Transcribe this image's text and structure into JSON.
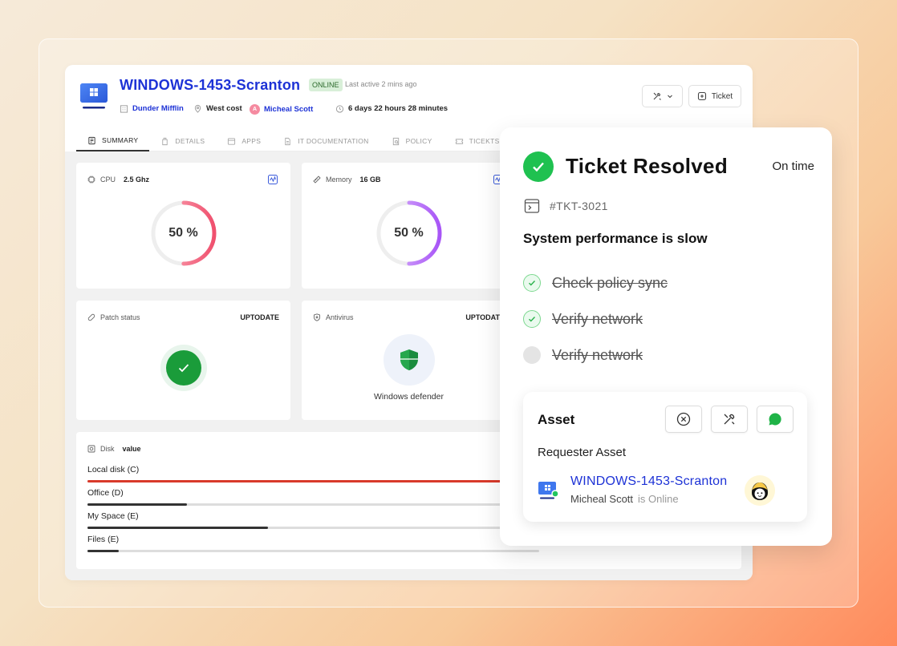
{
  "device": {
    "title": "WINDOWS-1453-Scranton",
    "status_badge": "ONLINE",
    "last_active": "Last active 2 mins ago",
    "company": "Dunder Mifflin",
    "location": "West cost",
    "user_initial": "A",
    "user": "Micheal Scott",
    "uptime": "6 days 22 hours 28 minutes"
  },
  "toolbar": {
    "ticket_label": "Ticket"
  },
  "tabs": [
    {
      "label": "SUMMARY",
      "icon": "summary-icon",
      "active": true
    },
    {
      "label": "DETAILS",
      "icon": "details-icon"
    },
    {
      "label": "APPS",
      "icon": "apps-icon"
    },
    {
      "label": "IT DOCUMENTATION",
      "icon": "document-icon"
    },
    {
      "label": "POLICY",
      "icon": "policy-icon"
    },
    {
      "label": "TICEKTS",
      "icon": "ticket-icon"
    }
  ],
  "cards": {
    "cpu": {
      "label": "CPU",
      "value": "2.5 Ghz",
      "percent_text": "50 %",
      "percent": 50
    },
    "memory": {
      "label": "Memory",
      "value": "16 GB",
      "percent_text": "50 %",
      "percent": 50
    },
    "patch": {
      "label": "Patch status",
      "status": "UPTODATE"
    },
    "antivirus": {
      "label": "Antivirus",
      "status": "UPTODATE",
      "product": "Windows defender"
    },
    "disk": {
      "label": "Disk",
      "value": "value",
      "items": [
        {
          "name": "Local disk (C)",
          "fill": 0.92,
          "color": "#d93a2b"
        },
        {
          "name": "Office (D)",
          "fill": 0.22,
          "color": "#333333"
        },
        {
          "name": "My Space (E)",
          "fill": 0.4,
          "color": "#333333"
        },
        {
          "name": "Files (E)",
          "fill": 0.07,
          "color": "#333333"
        }
      ]
    }
  },
  "ticket": {
    "title": "Ticket Resolved",
    "timing": "On time",
    "id": "#TKT-3021",
    "issue": "System performance is slow",
    "checklist": [
      {
        "label": "Check policy sync",
        "done": true
      },
      {
        "label": "Verify network",
        "done": true
      },
      {
        "label": "Verify network",
        "done": false
      }
    ]
  },
  "asset": {
    "title": "Asset",
    "requester_label": "Requester Asset",
    "name": "WINDOWS-1453-Scranton",
    "user": "Micheal Scott",
    "status": "is Online"
  },
  "colors": {
    "brand_blue": "#1d32d6",
    "success_green": "#1fc150",
    "cpu_gauge": "#f0506e",
    "memory_gauge": "#a855f7",
    "danger_red": "#d93a2b"
  }
}
